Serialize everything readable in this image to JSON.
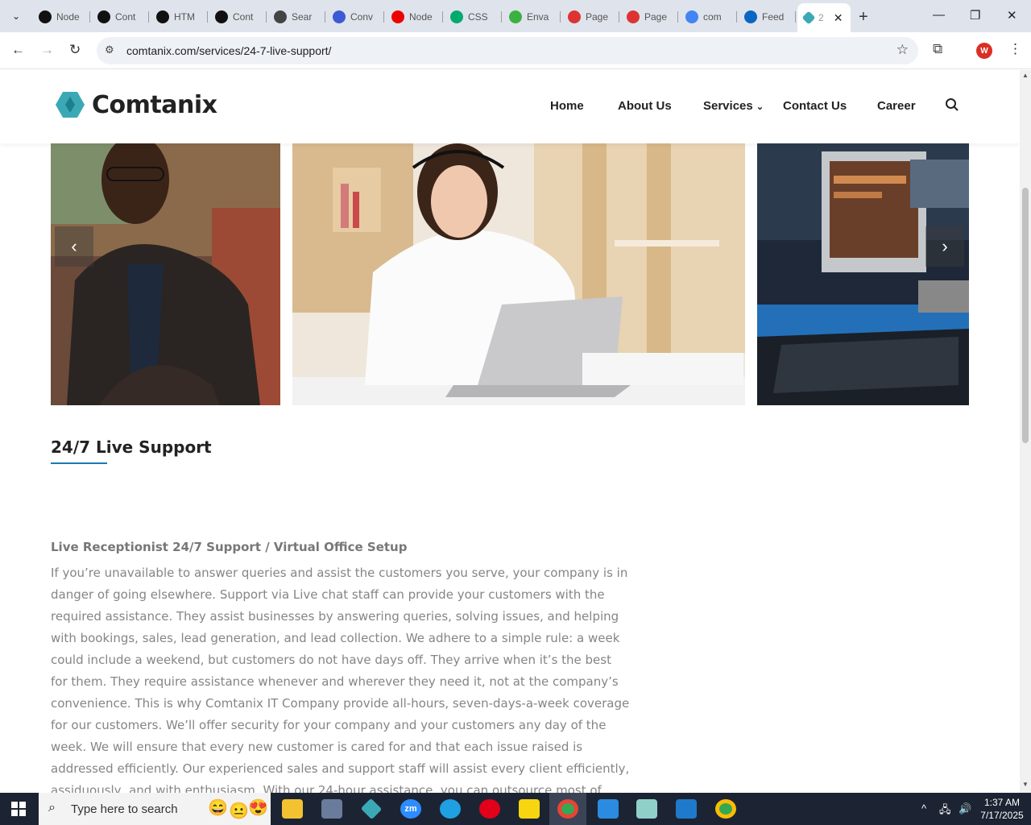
{
  "browser": {
    "tabs": [
      {
        "label": "Node",
        "icon": "threads-icon",
        "color": "#111"
      },
      {
        "label": "Cont",
        "icon": "threads-icon",
        "color": "#111"
      },
      {
        "label": "HTM",
        "icon": "threads-icon",
        "color": "#111"
      },
      {
        "label": "Cont",
        "icon": "threads-icon",
        "color": "#111"
      },
      {
        "label": "Sear",
        "icon": "wordpress-icon",
        "color": "#444"
      },
      {
        "label": "Conv",
        "icon": "converter-icon",
        "color": "#3b5bd6"
      },
      {
        "label": "Node",
        "icon": "youtube-icon",
        "color": "#e00"
      },
      {
        "label": "CSS",
        "icon": "w3-icon",
        "color": "#04aa6d"
      },
      {
        "label": "Enva",
        "icon": "envato-icon",
        "color": "#3cb043"
      },
      {
        "label": "Page",
        "icon": "pagespeed-icon",
        "color": "#d33"
      },
      {
        "label": "Page",
        "icon": "pagespeed-icon",
        "color": "#d33"
      },
      {
        "label": "com",
        "icon": "google-icon",
        "color": "#4285f4"
      },
      {
        "label": "Feed",
        "icon": "linkedin-icon",
        "color": "#0a66c2"
      }
    ],
    "active_tab": {
      "label": "2",
      "icon": "comtanix-icon"
    },
    "url": "comtanix.com/services/24-7-live-support/",
    "profile_initial": "W"
  },
  "site": {
    "brand": "Comtanix",
    "nav": [
      "Home",
      "About Us",
      "Services",
      "Contact Us",
      "Career"
    ],
    "content": {
      "title": "24/7 Live Support",
      "subheading": "Live Receptionist 24/7 Support / Virtual Office Setup",
      "paragraph": "If you’re unavailable to answer queries and assist the customers you serve, your company is in danger of going elsewhere. Support via Live chat staff can provide your customers with the required assistance. They assist businesses by answering queries, solving issues, and helping with bookings, sales, lead generation, and lead collection. We adhere to a simple rule: a week could include a weekend, but customers do not have days off. They arrive when it’s the best for them. They require assistance whenever and wherever they need it, not at the company’s convenience. This is why Comtanix  IT Company provide all-hours, seven-days-a-week coverage for our customers. We’ll offer security for your company and your customers any day of the week. We will ensure that every new customer is cared for and that each issue raised is addressed efficiently. Our experienced sales and support staff will assist every client efficiently, assiduously, and with enthusiasm. With our 24-hour assistance, you can outsource most of your work through email, chat, or calls."
    },
    "colors": {
      "accent": "#1a7ab0",
      "logo": "#3aa9b5"
    }
  },
  "taskbar": {
    "search_placeholder": "Type here to search",
    "time": "1:37 AM",
    "date": "7/17/2025"
  }
}
